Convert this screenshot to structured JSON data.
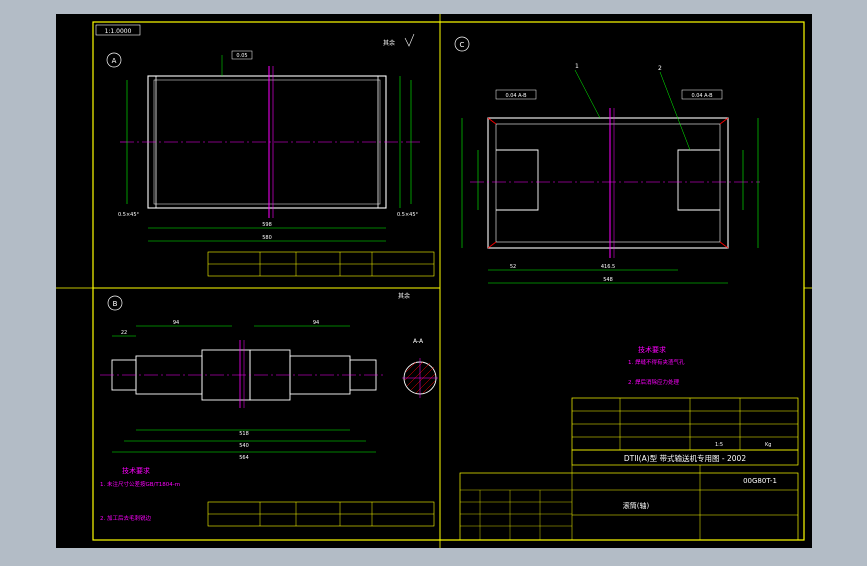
{
  "colors": {
    "background": "#b3bcc6",
    "sheet": "#000000",
    "frame": "#ffff00",
    "outline": "#ffffff",
    "dimension": "#00ff00",
    "centerline": "#ff00ff",
    "section": "#ff0000",
    "annotation": "#00ffff"
  },
  "title_tag": "1:1.0000",
  "view_a": {
    "label": "A",
    "roughness_note": "其余",
    "dim_total": "598",
    "dim_inner": "580",
    "chamfer_left": "0.5×45°",
    "chamfer_right": "0.5×45°",
    "tol_box": "0.05"
  },
  "view_b": {
    "label": "B",
    "roughness_note": "其余",
    "section_label": "A-A",
    "dim_total": "564",
    "dim_mid": "540",
    "dim_inner": "518",
    "dim_left": "22",
    "dim_top_left": "94",
    "dim_top_right": "94"
  },
  "view_c": {
    "label": "C",
    "dim_total": "548",
    "dim_inner": "416.5",
    "dim_left": "52",
    "tag1": "1",
    "tag2": "2",
    "tol_left": "0.04 A-B",
    "tol_right": "0.04 A-B"
  },
  "notes_b": {
    "heading": "技术要求",
    "items": [
      "1. 未注尺寸公差按GB/T1804-m",
      "2. 加工后去毛刺锐边"
    ]
  },
  "notes_c": {
    "heading": "技术要求",
    "items": [
      "1. 焊缝不得有夹渣气孔",
      "2. 焊后消除应力处理"
    ]
  },
  "title_block": {
    "title": "DTII(A)型 带式输送机专用图 - 2002",
    "drawing_no": "00G80T-1",
    "part_name": "滚筒(轴)",
    "scale": "1:5",
    "weight": "Kg"
  }
}
